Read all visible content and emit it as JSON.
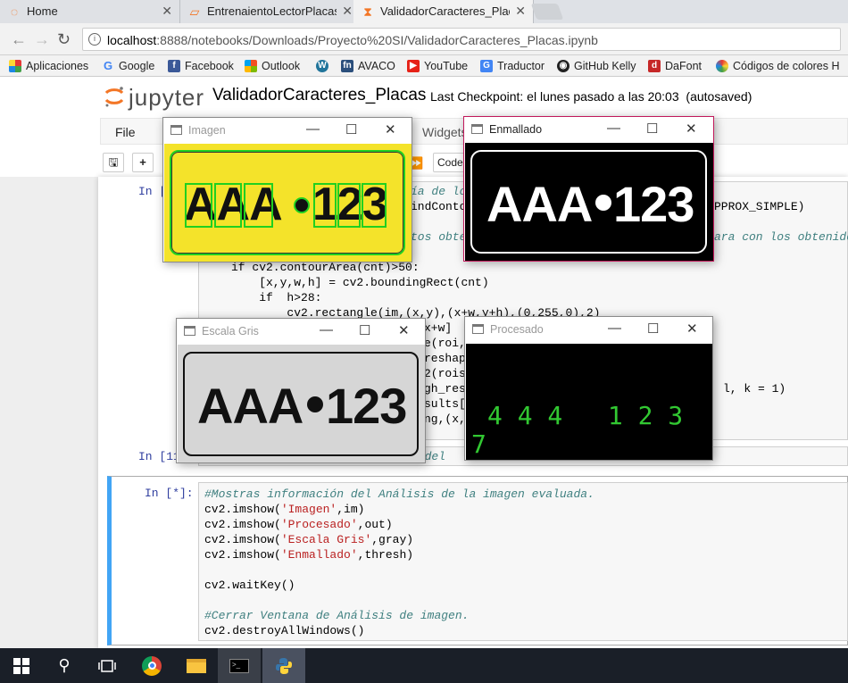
{
  "browser": {
    "tabs": [
      {
        "label": "Home",
        "icon": "jupyter-icon"
      },
      {
        "label": "EntrenaientoLectorPlacas",
        "icon": "notebook-icon"
      },
      {
        "label": "ValidadorCaracteres_Plac",
        "icon": "hourglass-icon"
      }
    ],
    "url_host": "localhost",
    "url_rest": ":8888/notebooks/Downloads/Proyecto%20SI/ValidadorCaracteres_Placas.ipynb",
    "bookmarks": [
      "Aplicaciones",
      "Google",
      "Facebook",
      "Outlook",
      "AVACO",
      "YouTube",
      "Traductor",
      "GitHub Kelly",
      "DaFont",
      "Códigos de colores H"
    ]
  },
  "jupyter": {
    "logo": "jupyter",
    "notebook_title": "ValidadorCaracteres_Placas",
    "checkpoint": "Last Checkpoint: el lunes pasado a las 20:03",
    "autosaved": "(autosaved)",
    "menu_file": "File",
    "menu_widgets": "Widgets",
    "cell_type": "Code"
  },
  "cells": {
    "prompt_a": "In [",
    "prompt_b": "In [11",
    "prompt_c": "In [*]:",
    "bg_lines": [
      "ía de lo",
      "indConto",
      "PPROX_SIMPLE)",
      "tos obte",
      "ara con los obtenido",
      "if cv2.contourArea(cnt)>50:",
      "    [x,y,w,h] = cv2.boundingRect(cnt)",
      "    if  h>28:",
      "        cv2.rectangle(im,(x,y),(x+w,y+h),(0,255,0),2)",
      "x+w]",
      "e(roi,",
      "reshap",
      "2(rois",
      "gh_res",
      "l, k = 1)",
      "sults[",
      "ng,(x,",
      "s del"
    ],
    "active_code": [
      "#Mostras información del Análisis de la imagen evaluada.",
      "cv2.imshow('Imagen',im)",
      "cv2.imshow('Procesado',out)",
      "cv2.imshow('Escala Gris',gray)",
      "cv2.imshow('Enmallado',thresh)",
      "",
      "cv2.waitKey()",
      "",
      "#Cerrar Ventana de Análisis de imagen.",
      "cv2.destroyAllWindows()"
    ]
  },
  "windows": {
    "imagen": {
      "title": "Imagen",
      "plate_letters": "AAA",
      "plate_numbers": "123"
    },
    "enmallado": {
      "title": "Enmallado",
      "plate_letters": "AAA",
      "plate_numbers": "123"
    },
    "escala_gris": {
      "title": "Escala Gris",
      "plate_letters": "AAA",
      "plate_numbers": "123"
    },
    "procesado": {
      "title": "Procesado",
      "line1": "4 4 4   1 2 3",
      "line2": "7"
    }
  },
  "colors": {
    "plate_yellow": "#f4e32a",
    "box_green": "#20d020",
    "digit_green": "#32c832",
    "jupyter_orange": "#f37626",
    "selected_cell_bar": "#42a5f5",
    "taskbar": "#1a1f28"
  }
}
